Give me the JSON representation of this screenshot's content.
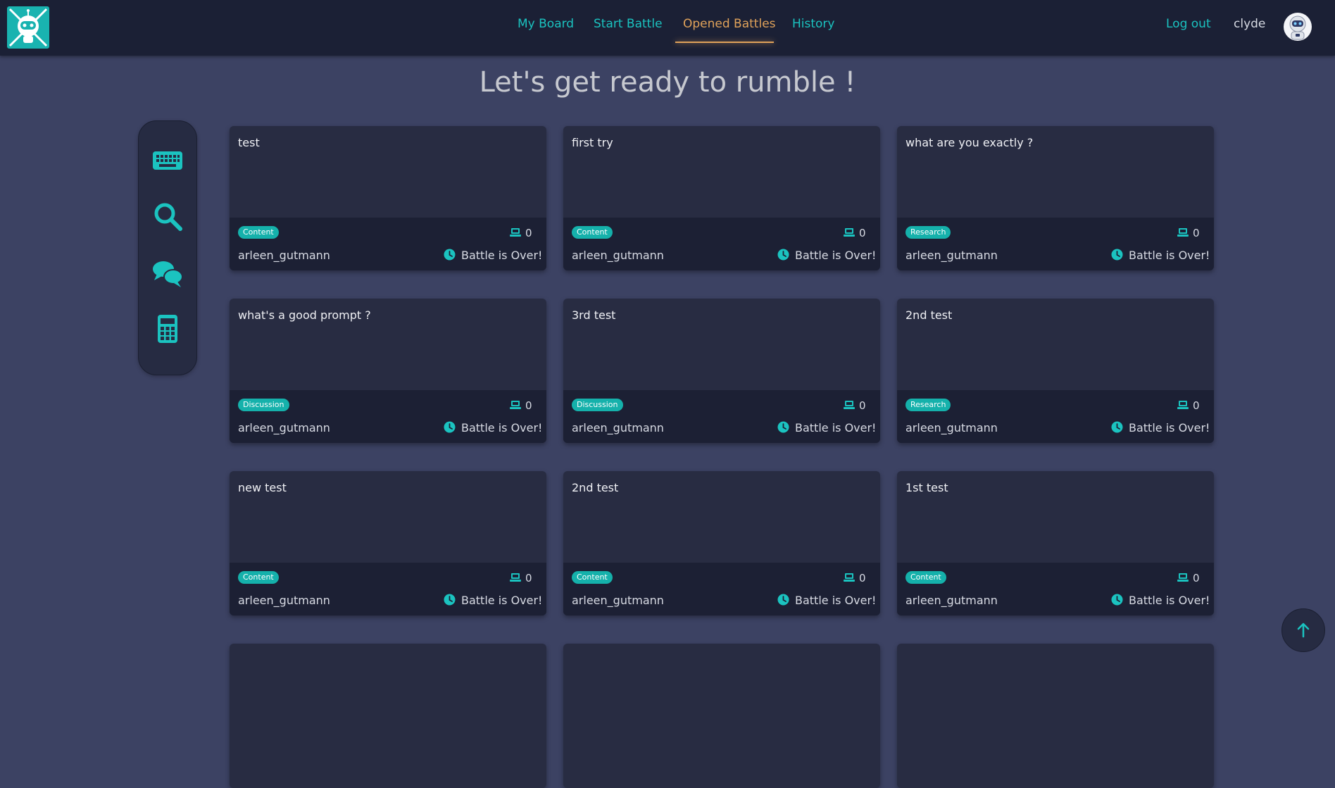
{
  "header": {
    "nav": [
      {
        "label": "My Board"
      },
      {
        "label": "Start Battle"
      },
      {
        "label": "Opened Battles"
      },
      {
        "label": "History"
      }
    ],
    "active_tab": "Opened Battles",
    "logout_label": "Log out",
    "username": "clyde"
  },
  "page": {
    "title": "Let's get ready to rumble !"
  },
  "sidebar": {
    "items": [
      {
        "icon": "keyboard-icon"
      },
      {
        "icon": "search-icon"
      },
      {
        "icon": "comments-icon"
      },
      {
        "icon": "calculator-icon"
      }
    ]
  },
  "cards": [
    {
      "title": "test",
      "category": "Content",
      "count": "0",
      "author": "arleen_gutmann",
      "status": "Battle is Over!"
    },
    {
      "title": "first try",
      "category": "Content",
      "count": "0",
      "author": "arleen_gutmann",
      "status": "Battle is Over!"
    },
    {
      "title": "what are you exactly ?",
      "category": "Research",
      "count": "0",
      "author": "arleen_gutmann",
      "status": "Battle is Over!"
    },
    {
      "title": "what's a good prompt ?",
      "category": "Discussion",
      "count": "0",
      "author": "arleen_gutmann",
      "status": "Battle is Over!"
    },
    {
      "title": "3rd test",
      "category": "Discussion",
      "count": "0",
      "author": "arleen_gutmann",
      "status": "Battle is Over!"
    },
    {
      "title": "2nd test",
      "category": "Research",
      "count": "0",
      "author": "arleen_gutmann",
      "status": "Battle is Over!"
    },
    {
      "title": "new test",
      "category": "Content",
      "count": "0",
      "author": "arleen_gutmann",
      "status": "Battle is Over!"
    },
    {
      "title": "2nd test",
      "category": "Content",
      "count": "0",
      "author": "arleen_gutmann",
      "status": "Battle is Over!"
    },
    {
      "title": "1st test",
      "category": "Content",
      "count": "0",
      "author": "arleen_gutmann",
      "status": "Battle is Over!"
    },
    {
      "title": "",
      "category": "",
      "count": "",
      "author": "",
      "status": ""
    },
    {
      "title": "",
      "category": "",
      "count": "",
      "author": "",
      "status": ""
    },
    {
      "title": "",
      "category": "",
      "count": "",
      "author": "",
      "status": ""
    }
  ],
  "colors": {
    "accent": "#1bc3c0",
    "active_tab": "#e0a25a",
    "badge": "#15b1ab",
    "background": "#3c4263",
    "header": "#1b2035"
  }
}
